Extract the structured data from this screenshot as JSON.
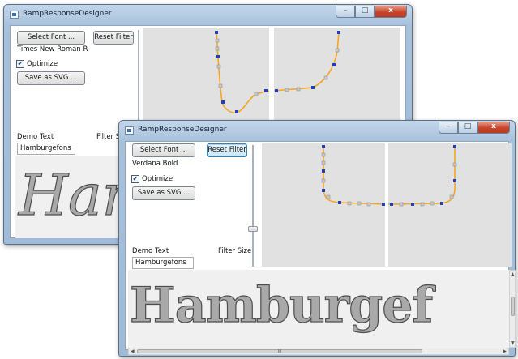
{
  "window_back": {
    "title": "RampResponseDesigner",
    "buttons": {
      "minimize": "–",
      "maximize": "□",
      "close": "x"
    },
    "select_font_label": "Select Font ...",
    "reset_filter_label": "Reset Filter",
    "font_name": "Times New Roman R",
    "optimize_label": "Optimize",
    "optimize_checked": "✔",
    "save_svg_label": "Save as SVG ...",
    "demo_text_label": "Demo Text",
    "filter_size_label": "Filter S",
    "demo_text_value": "Hamburgefons",
    "preview_text": "Ham"
  },
  "window_front": {
    "title": "RampResponseDesigner",
    "buttons": {
      "minimize": "–",
      "maximize": "□",
      "close": "x"
    },
    "select_font_label": "Select Font ...",
    "reset_filter_label": "Reset Filter",
    "font_name": "Verdana Bold",
    "optimize_label": "Optimize",
    "optimize_checked": "✔",
    "save_svg_label": "Save as SVG ...",
    "demo_text_label": "Demo Text",
    "filter_size_label": "Filter Size",
    "demo_text_value": "Hamburgefons",
    "preview_text": "Hamburgef",
    "scrollbar_grip": "III"
  },
  "colors": {
    "curve": "#f5a623",
    "control_point": "#1f3fbf",
    "panel_bg": "#e1e1e1",
    "preview_fill": "#a9a9a9"
  }
}
